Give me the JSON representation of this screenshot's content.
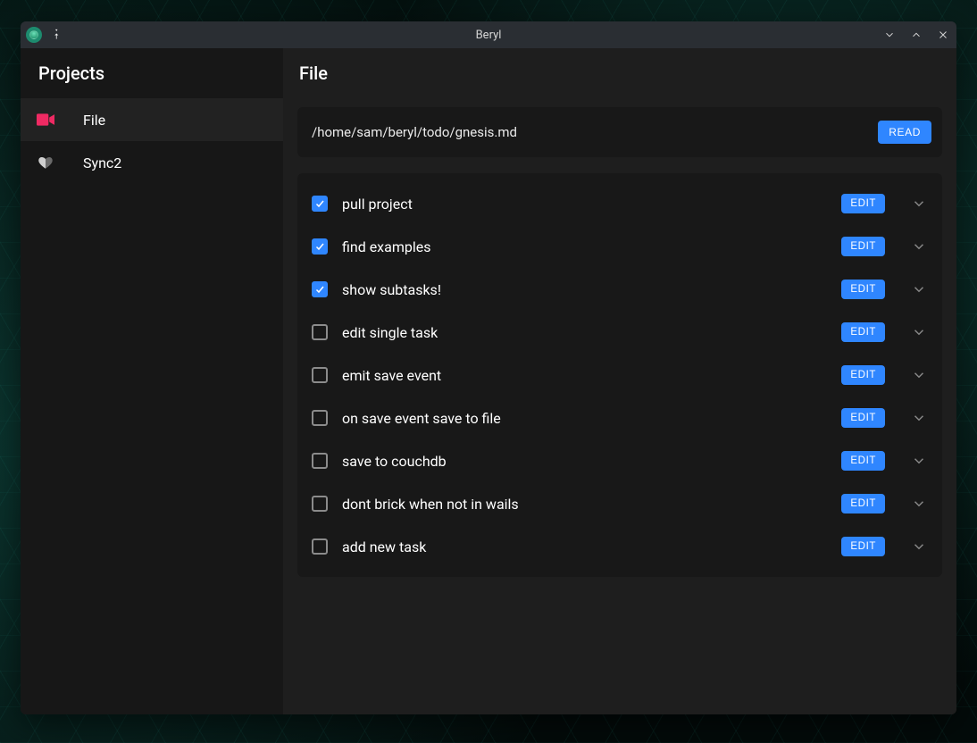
{
  "window": {
    "title": "Beryl"
  },
  "sidebar": {
    "header": "Projects",
    "items": [
      {
        "label": "File",
        "icon": "video",
        "active": true
      },
      {
        "label": "Sync2",
        "icon": "heart",
        "active": false
      }
    ]
  },
  "main": {
    "header": "File",
    "file_path": "/home/sam/beryl/todo/gnesis.md",
    "read_button": "READ",
    "edit_button": "EDIT",
    "tasks": [
      {
        "label": "pull project",
        "done": true
      },
      {
        "label": "find examples",
        "done": true
      },
      {
        "label": "show subtasks!",
        "done": true
      },
      {
        "label": "edit single task",
        "done": false
      },
      {
        "label": "emit save event",
        "done": false
      },
      {
        "label": "on save event save to file",
        "done": false
      },
      {
        "label": "save to couchdb",
        "done": false
      },
      {
        "label": "dont brick when not in wails",
        "done": false
      },
      {
        "label": "add new task",
        "done": false
      }
    ]
  }
}
